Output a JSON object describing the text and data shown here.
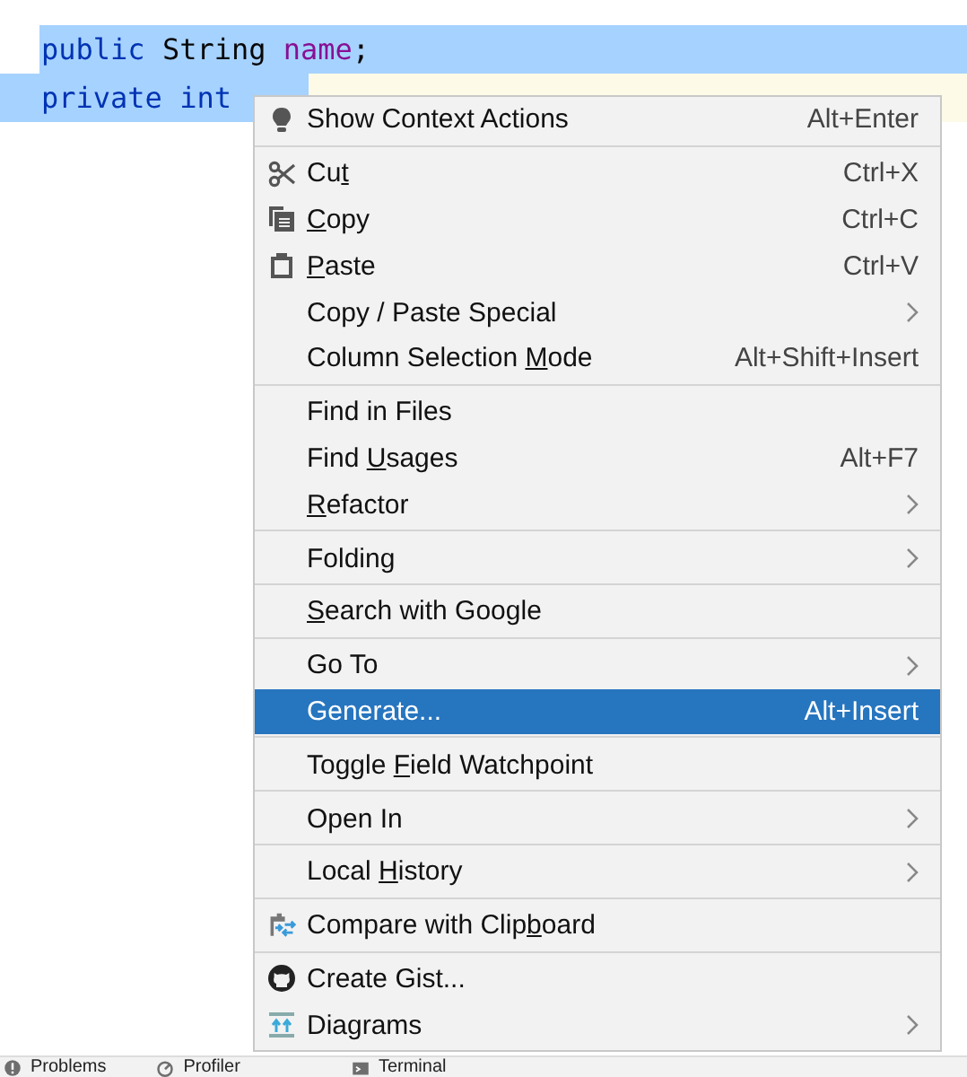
{
  "editor": {
    "lines": [
      {
        "tokens": [
          {
            "text": "public ",
            "kind": "kw"
          },
          {
            "text": "String ",
            "kind": "plain"
          },
          {
            "text": "name",
            "kind": "field"
          },
          {
            "text": ";",
            "kind": "plain"
          }
        ],
        "kind": "selected"
      },
      {
        "tokens": [
          {
            "text": "private ",
            "kind": "kw"
          },
          {
            "text": "int",
            "kind": "kw"
          }
        ],
        "kind": "caret"
      }
    ]
  },
  "context_menu": {
    "groups": [
      [
        {
          "kind": "bulb",
          "label_parts": [
            {
              "text": "Show Context Actions",
              "mnemonic": false
            }
          ],
          "shortcut": "Alt+Enter",
          "submenu": false,
          "selected": false
        }
      ],
      [
        {
          "kind": "scissors",
          "label_parts": [
            {
              "text": "Cu",
              "mnemonic": false
            },
            {
              "text": "t",
              "mnemonic": true
            }
          ],
          "shortcut": "Ctrl+X",
          "submenu": false,
          "selected": false
        },
        {
          "kind": "copy",
          "label_parts": [
            {
              "text": "C",
              "mnemonic": true
            },
            {
              "text": "opy",
              "mnemonic": false
            }
          ],
          "shortcut": "Ctrl+C",
          "submenu": false,
          "selected": false
        },
        {
          "kind": "paste",
          "label_parts": [
            {
              "text": "P",
              "mnemonic": true
            },
            {
              "text": "aste",
              "mnemonic": false
            }
          ],
          "shortcut": "Ctrl+V",
          "submenu": false,
          "selected": false
        },
        {
          "kind": "plain",
          "label_parts": [
            {
              "text": "Copy / Paste Special",
              "mnemonic": false
            }
          ],
          "submenu": true,
          "selected": false
        },
        {
          "kind": "plain",
          "label_parts": [
            {
              "text": "Column Selection ",
              "mnemonic": false
            },
            {
              "text": "M",
              "mnemonic": true
            },
            {
              "text": "ode",
              "mnemonic": false
            }
          ],
          "shortcut": "Alt+Shift+Insert",
          "submenu": false,
          "selected": false
        }
      ],
      [
        {
          "kind": "plain",
          "label_parts": [
            {
              "text": "Find in Files",
              "mnemonic": false
            }
          ],
          "submenu": false,
          "selected": false
        },
        {
          "kind": "plain",
          "label_parts": [
            {
              "text": "Find ",
              "mnemonic": false
            },
            {
              "text": "U",
              "mnemonic": true
            },
            {
              "text": "sages",
              "mnemonic": false
            }
          ],
          "shortcut": "Alt+F7",
          "submenu": false,
          "selected": false
        },
        {
          "kind": "plain",
          "label_parts": [
            {
              "text": "R",
              "mnemonic": true
            },
            {
              "text": "efactor",
              "mnemonic": false
            }
          ],
          "submenu": true,
          "selected": false
        }
      ],
      [
        {
          "kind": "plain",
          "label_parts": [
            {
              "text": "Folding",
              "mnemonic": false
            }
          ],
          "submenu": true,
          "selected": false
        }
      ],
      [
        {
          "kind": "plain",
          "label_parts": [
            {
              "text": "S",
              "mnemonic": true
            },
            {
              "text": "earch with Google",
              "mnemonic": false
            }
          ],
          "submenu": false,
          "selected": false
        }
      ],
      [
        {
          "kind": "plain",
          "label_parts": [
            {
              "text": "Go To",
              "mnemonic": false
            }
          ],
          "submenu": true,
          "selected": false
        },
        {
          "kind": "plain",
          "label_parts": [
            {
              "text": "Generate...",
              "mnemonic": false
            }
          ],
          "shortcut": "Alt+Insert",
          "submenu": false,
          "selected": true
        }
      ],
      [
        {
          "kind": "plain",
          "label_parts": [
            {
              "text": "Toggle ",
              "mnemonic": false
            },
            {
              "text": "F",
              "mnemonic": true
            },
            {
              "text": "ield Watchpoint",
              "mnemonic": false
            }
          ],
          "submenu": false,
          "selected": false
        }
      ],
      [
        {
          "kind": "plain",
          "label_parts": [
            {
              "text": "Open In",
              "mnemonic": false
            }
          ],
          "submenu": true,
          "selected": false
        }
      ],
      [
        {
          "kind": "plain",
          "label_parts": [
            {
              "text": "Local ",
              "mnemonic": false
            },
            {
              "text": "H",
              "mnemonic": true
            },
            {
              "text": "istory",
              "mnemonic": false
            }
          ],
          "submenu": true,
          "selected": false
        }
      ],
      [
        {
          "kind": "compare",
          "label_parts": [
            {
              "text": "Compare with Clip",
              "mnemonic": false
            },
            {
              "text": "b",
              "mnemonic": true
            },
            {
              "text": "oard",
              "mnemonic": false
            }
          ],
          "submenu": false,
          "selected": false
        }
      ],
      [
        {
          "kind": "github",
          "label_parts": [
            {
              "text": "Create Gist...",
              "mnemonic": false
            }
          ],
          "submenu": false,
          "selected": false
        },
        {
          "kind": "diagrams",
          "label_parts": [
            {
              "text": "Diagrams",
              "mnemonic": false
            }
          ],
          "submenu": true,
          "selected": false
        }
      ]
    ]
  },
  "status_bar": {
    "tabs": [
      {
        "kind": "problems",
        "label": "Problems"
      },
      {
        "kind": "profiler",
        "label": "Profiler"
      },
      {
        "kind": "terminal",
        "label": "Terminal"
      }
    ]
  }
}
